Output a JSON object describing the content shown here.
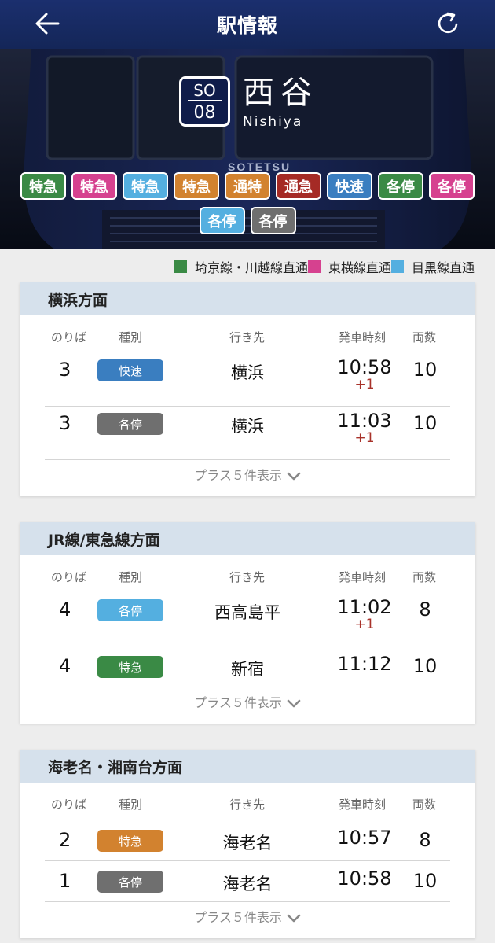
{
  "header": {
    "title": "駅情報"
  },
  "station": {
    "line_code": "SO",
    "number": "08",
    "name_jp": "西谷",
    "name_en": "Nishiya"
  },
  "hero_mark": "SOTETSU",
  "chips_row1": [
    {
      "label": "特急",
      "color": "#3a8a45"
    },
    {
      "label": "特急",
      "color": "#d6418f"
    },
    {
      "label": "特急",
      "color": "#54afe0"
    },
    {
      "label": "特急",
      "color": "#d2822f"
    },
    {
      "label": "通特",
      "color": "#d2822f"
    },
    {
      "label": "通急",
      "color": "#a52a25"
    },
    {
      "label": "快速",
      "color": "#3a7ec0"
    },
    {
      "label": "各停",
      "color": "#3a8a45"
    },
    {
      "label": "各停",
      "color": "#d6418f"
    }
  ],
  "chips_row2": [
    {
      "label": "各停",
      "color": "#54afe0"
    },
    {
      "label": "各停",
      "color": "#6f6f6f"
    }
  ],
  "legend": [
    {
      "label": "埼京線・川越線直通",
      "color": "#3a8a45"
    },
    {
      "label": "東横線直通",
      "color": "#d6418f"
    },
    {
      "label": "目黒線直通",
      "color": "#54afe0"
    }
  ],
  "columns": {
    "platform": "のりば",
    "type": "種別",
    "destination": "行き先",
    "departure": "発車時刻",
    "cars": "両数"
  },
  "sections": [
    {
      "title": "横浜方面",
      "more": "プラス５件表示",
      "rows": [
        {
          "platform": "3",
          "type": "快速",
          "type_color": "#3a7ec0",
          "destination": "横浜",
          "time": "10:58",
          "delay": "+1",
          "cars": "10"
        },
        {
          "platform": "3",
          "type": "各停",
          "type_color": "#6f6f6f",
          "destination": "横浜",
          "time": "11:03",
          "delay": "+1",
          "cars": "10"
        }
      ]
    },
    {
      "title": "JR線/東急線方面",
      "more": "プラス５件表示",
      "rows": [
        {
          "platform": "4",
          "type": "各停",
          "type_color": "#54afe0",
          "destination": "西高島平",
          "time": "11:02",
          "delay": "+1",
          "cars": "8"
        },
        {
          "platform": "4",
          "type": "特急",
          "type_color": "#3a8a45",
          "destination": "新宿",
          "time": "11:12",
          "delay": "",
          "cars": "10"
        }
      ]
    },
    {
      "title": "海老名・湘南台方面",
      "more": "プラス５件表示",
      "rows": [
        {
          "platform": "2",
          "type": "特急",
          "type_color": "#d2822f",
          "destination": "海老名",
          "time": "10:57",
          "delay": "",
          "cars": "8"
        },
        {
          "platform": "1",
          "type": "各停",
          "type_color": "#6f6f6f",
          "destination": "海老名",
          "time": "10:58",
          "delay": "",
          "cars": "10"
        }
      ]
    }
  ]
}
